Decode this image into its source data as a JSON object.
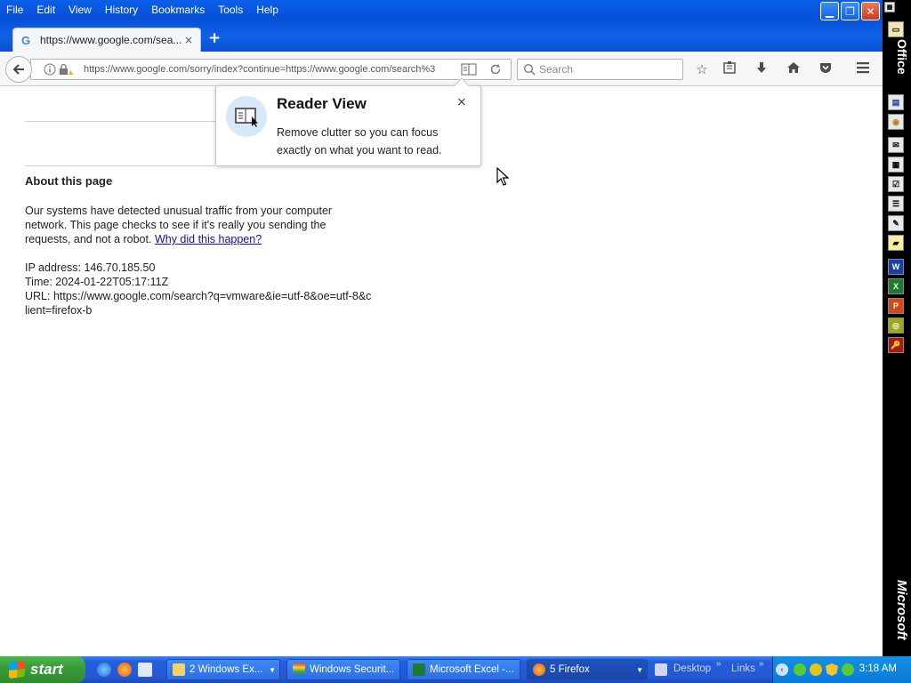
{
  "menu": [
    "File",
    "Edit",
    "View",
    "History",
    "Bookmarks",
    "Tools",
    "Help"
  ],
  "tab": {
    "title": "https://www.google.com/sea...",
    "close": "×",
    "new": "+"
  },
  "url": "https://www.google.com/sorry/index?continue=https://www.google.com/search%3",
  "search_placeholder": "Search",
  "page": {
    "heading": "About this page",
    "para": "Our systems have detected unusual traffic from your computer network. This page checks to see if it's really you sending the requests, and not a robot.",
    "link": "Why did this happen?",
    "ip": "IP address: 146.70.185.50",
    "time": "Time: 2024-01-22T05:17:11Z",
    "url_line": "URL: https://www.google.com/search?q=vmware&ie=utf-8&oe=utf-8&client=firefox-b"
  },
  "reader_popup": {
    "title": "Reader View",
    "desc": "Remove clutter so you can focus exactly on what you want to read.",
    "close": "×"
  },
  "officebar": {
    "top_label": "Office",
    "bottom_label": "Microsoft"
  },
  "taskbar": {
    "start": "start",
    "tasks": [
      "2 Windows Ex...",
      "Windows Securit...",
      "Microsoft Excel -...",
      "5 Firefox"
    ],
    "desktop": "Desktop",
    "links": "Links",
    "clock": "3:18 AM"
  },
  "colors": {
    "title_blue": "#0a5fe8",
    "taskbar_blue": "#245edb",
    "link": "#1a0dab",
    "start_green": "#3a9d3a"
  }
}
